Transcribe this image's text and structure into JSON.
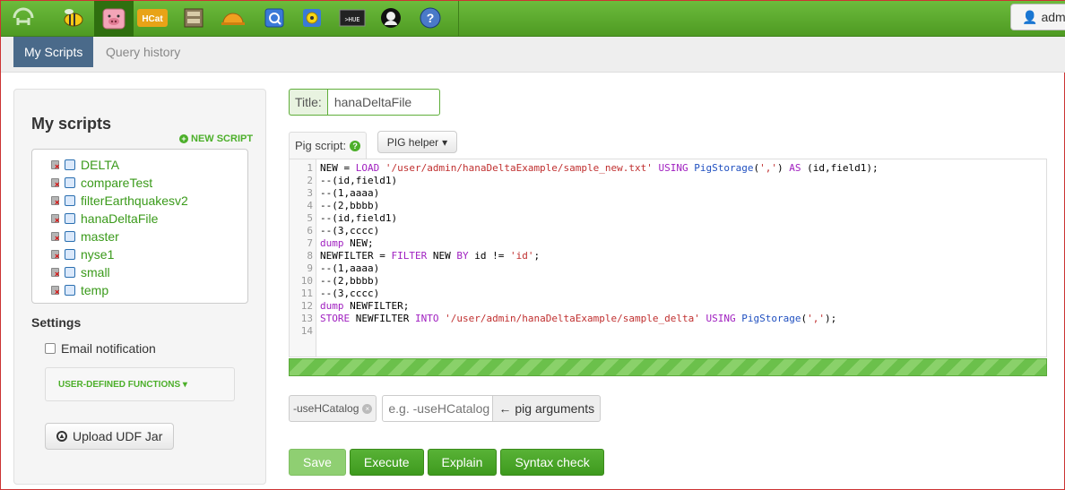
{
  "topbar": {
    "icons": [
      "hue-logo-icon",
      "bee-icon",
      "pig-icon",
      "hcat-icon",
      "file-browser-icon",
      "job-hardhat-icon",
      "job-designer-icon",
      "oozie-icon",
      "shell-icon",
      "user-admin-icon",
      "help-icon"
    ],
    "hcat_label": "HCat",
    "shell_label": ">HUE",
    "user_label": "admi"
  },
  "subnav": {
    "tabs": [
      {
        "label": "My Scripts",
        "active": true
      },
      {
        "label": "Query history",
        "active": false
      }
    ]
  },
  "sidebar": {
    "title": "My scripts",
    "new_script": "NEW SCRIPT",
    "scripts": [
      "DELTA",
      "compareTest",
      "filterEarthquakesv2",
      "hanaDeltaFile",
      "master",
      "nyse1",
      "small",
      "temp"
    ],
    "settings_title": "Settings",
    "email_notification": "Email notification",
    "udf_label": "USER-DEFINED FUNCTIONS",
    "upload_label": "Upload UDF Jar"
  },
  "main": {
    "title_label": "Title:",
    "title_value": "hanaDeltaFile",
    "editor_tab": "Pig script:",
    "pig_helper": "PIG helper",
    "line_numbers": [
      "1",
      "2",
      "3",
      "4",
      "5",
      "6",
      "7",
      "8",
      "9",
      "10",
      "11",
      "12",
      "13",
      "14"
    ],
    "args": {
      "tag": "-useHCatalog",
      "placeholder": "e.g. -useHCatalog",
      "button": "pig arguments"
    },
    "buttons": {
      "save": "Save",
      "execute": "Execute",
      "explain": "Explain",
      "syntax_check": "Syntax check"
    }
  },
  "colors": {
    "topbar_green": "#4e9a22",
    "active_tab": "#4a6a8a",
    "link_green": "#3a9a1a",
    "button_green": "#3e9a1e"
  }
}
